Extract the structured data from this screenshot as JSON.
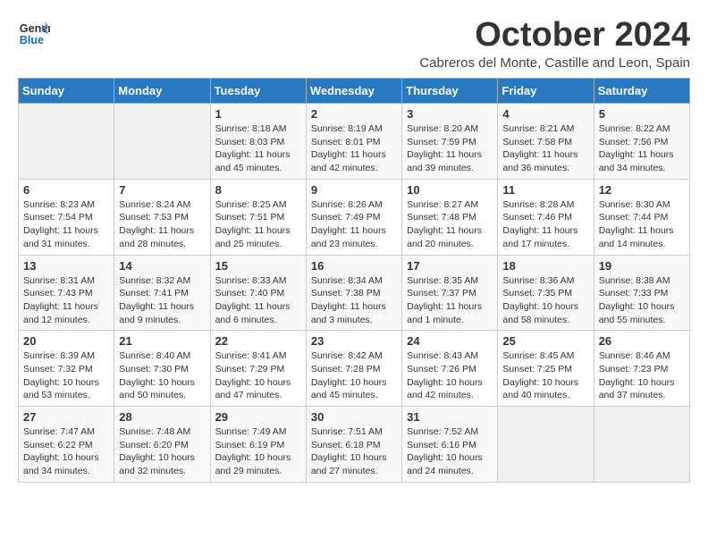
{
  "header": {
    "logo_line1": "General",
    "logo_line2": "Blue",
    "month_title": "October 2024",
    "subtitle": "Cabreros del Monte, Castille and Leon, Spain"
  },
  "days_of_week": [
    "Sunday",
    "Monday",
    "Tuesday",
    "Wednesday",
    "Thursday",
    "Friday",
    "Saturday"
  ],
  "weeks": [
    [
      {
        "day": "",
        "info": ""
      },
      {
        "day": "",
        "info": ""
      },
      {
        "day": "1",
        "info": "Sunrise: 8:18 AM\nSunset: 8:03 PM\nDaylight: 11 hours and 45 minutes."
      },
      {
        "day": "2",
        "info": "Sunrise: 8:19 AM\nSunset: 8:01 PM\nDaylight: 11 hours and 42 minutes."
      },
      {
        "day": "3",
        "info": "Sunrise: 8:20 AM\nSunset: 7:59 PM\nDaylight: 11 hours and 39 minutes."
      },
      {
        "day": "4",
        "info": "Sunrise: 8:21 AM\nSunset: 7:58 PM\nDaylight: 11 hours and 36 minutes."
      },
      {
        "day": "5",
        "info": "Sunrise: 8:22 AM\nSunset: 7:56 PM\nDaylight: 11 hours and 34 minutes."
      }
    ],
    [
      {
        "day": "6",
        "info": "Sunrise: 8:23 AM\nSunset: 7:54 PM\nDaylight: 11 hours and 31 minutes."
      },
      {
        "day": "7",
        "info": "Sunrise: 8:24 AM\nSunset: 7:53 PM\nDaylight: 11 hours and 28 minutes."
      },
      {
        "day": "8",
        "info": "Sunrise: 8:25 AM\nSunset: 7:51 PM\nDaylight: 11 hours and 25 minutes."
      },
      {
        "day": "9",
        "info": "Sunrise: 8:26 AM\nSunset: 7:49 PM\nDaylight: 11 hours and 23 minutes."
      },
      {
        "day": "10",
        "info": "Sunrise: 8:27 AM\nSunset: 7:48 PM\nDaylight: 11 hours and 20 minutes."
      },
      {
        "day": "11",
        "info": "Sunrise: 8:28 AM\nSunset: 7:46 PM\nDaylight: 11 hours and 17 minutes."
      },
      {
        "day": "12",
        "info": "Sunrise: 8:30 AM\nSunset: 7:44 PM\nDaylight: 11 hours and 14 minutes."
      }
    ],
    [
      {
        "day": "13",
        "info": "Sunrise: 8:31 AM\nSunset: 7:43 PM\nDaylight: 11 hours and 12 minutes."
      },
      {
        "day": "14",
        "info": "Sunrise: 8:32 AM\nSunset: 7:41 PM\nDaylight: 11 hours and 9 minutes."
      },
      {
        "day": "15",
        "info": "Sunrise: 8:33 AM\nSunset: 7:40 PM\nDaylight: 11 hours and 6 minutes."
      },
      {
        "day": "16",
        "info": "Sunrise: 8:34 AM\nSunset: 7:38 PM\nDaylight: 11 hours and 3 minutes."
      },
      {
        "day": "17",
        "info": "Sunrise: 8:35 AM\nSunset: 7:37 PM\nDaylight: 11 hours and 1 minute."
      },
      {
        "day": "18",
        "info": "Sunrise: 8:36 AM\nSunset: 7:35 PM\nDaylight: 10 hours and 58 minutes."
      },
      {
        "day": "19",
        "info": "Sunrise: 8:38 AM\nSunset: 7:33 PM\nDaylight: 10 hours and 55 minutes."
      }
    ],
    [
      {
        "day": "20",
        "info": "Sunrise: 8:39 AM\nSunset: 7:32 PM\nDaylight: 10 hours and 53 minutes."
      },
      {
        "day": "21",
        "info": "Sunrise: 8:40 AM\nSunset: 7:30 PM\nDaylight: 10 hours and 50 minutes."
      },
      {
        "day": "22",
        "info": "Sunrise: 8:41 AM\nSunset: 7:29 PM\nDaylight: 10 hours and 47 minutes."
      },
      {
        "day": "23",
        "info": "Sunrise: 8:42 AM\nSunset: 7:28 PM\nDaylight: 10 hours and 45 minutes."
      },
      {
        "day": "24",
        "info": "Sunrise: 8:43 AM\nSunset: 7:26 PM\nDaylight: 10 hours and 42 minutes."
      },
      {
        "day": "25",
        "info": "Sunrise: 8:45 AM\nSunset: 7:25 PM\nDaylight: 10 hours and 40 minutes."
      },
      {
        "day": "26",
        "info": "Sunrise: 8:46 AM\nSunset: 7:23 PM\nDaylight: 10 hours and 37 minutes."
      }
    ],
    [
      {
        "day": "27",
        "info": "Sunrise: 7:47 AM\nSunset: 6:22 PM\nDaylight: 10 hours and 34 minutes."
      },
      {
        "day": "28",
        "info": "Sunrise: 7:48 AM\nSunset: 6:20 PM\nDaylight: 10 hours and 32 minutes."
      },
      {
        "day": "29",
        "info": "Sunrise: 7:49 AM\nSunset: 6:19 PM\nDaylight: 10 hours and 29 minutes."
      },
      {
        "day": "30",
        "info": "Sunrise: 7:51 AM\nSunset: 6:18 PM\nDaylight: 10 hours and 27 minutes."
      },
      {
        "day": "31",
        "info": "Sunrise: 7:52 AM\nSunset: 6:16 PM\nDaylight: 10 hours and 24 minutes."
      },
      {
        "day": "",
        "info": ""
      },
      {
        "day": "",
        "info": ""
      }
    ]
  ]
}
